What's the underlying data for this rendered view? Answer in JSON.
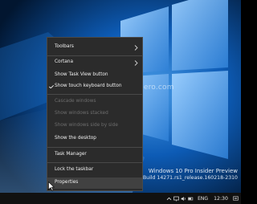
{
  "context_menu": {
    "items": [
      {
        "label": "Toolbars",
        "submenu": true,
        "enabled": true
      },
      {
        "label": "Cortana",
        "submenu": true,
        "enabled": true
      },
      {
        "label": "Show Task View button",
        "enabled": true
      },
      {
        "label": "Show touch keyboard button",
        "enabled": true
      },
      {
        "label": "Cascade windows",
        "enabled": false
      },
      {
        "label": "Show windows stacked",
        "enabled": false
      },
      {
        "label": "Show windows side by side",
        "enabled": false
      },
      {
        "label": "Show the desktop",
        "enabled": true
      },
      {
        "label": "Task Manager",
        "enabled": true
      },
      {
        "label": "Lock the taskbar",
        "enabled": true
      },
      {
        "label": "Properties",
        "enabled": true,
        "highlighted": true
      }
    ]
  },
  "watermark": {
    "text": "http://winaero.com"
  },
  "build_info": {
    "line1": "Windows 10 Pro Insider Preview",
    "line2": "ion copy. Build 14271.rs1_release.160218-2310"
  },
  "taskbar": {
    "language": "ENG",
    "clock": "12:30",
    "tray_icons": [
      "chevron-up-icon",
      "network-icon",
      "speaker-icon",
      "battery-icon",
      "notification-center-icon"
    ]
  },
  "colors": {
    "wallpaper_blue": "#0a4fa0",
    "menu_background": "#2b2b2b",
    "menu_text": "#f0f0f0",
    "menu_disabled_text": "#6d6d6d",
    "taskbar": "#111111"
  }
}
